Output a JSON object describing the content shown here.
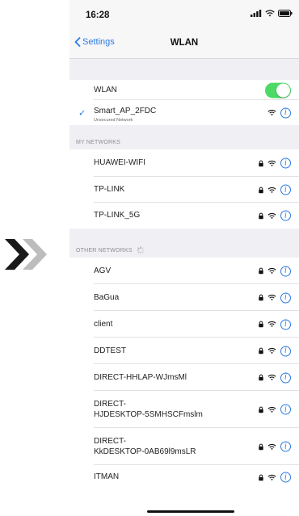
{
  "status": {
    "time": "16:28"
  },
  "nav": {
    "back_label": "Settings",
    "title": "WLAN"
  },
  "wlan": {
    "label": "WLAN",
    "enabled": true
  },
  "connected": {
    "name": "Smart_AP_2FDC",
    "subtitle": "Unsecured Network"
  },
  "my_networks": {
    "header": "MY NETWORKS",
    "items": [
      {
        "name": "HUAWEI-WIFI",
        "locked": true
      },
      {
        "name": "TP-LINK",
        "locked": true
      },
      {
        "name": "TP-LINK_5G",
        "locked": true
      }
    ]
  },
  "other_networks": {
    "header": "OTHER NETWORKS",
    "items": [
      {
        "name": "AGV",
        "locked": true
      },
      {
        "name": "BaGua",
        "locked": true
      },
      {
        "name": "client",
        "locked": true
      },
      {
        "name": "DDTEST",
        "locked": true
      },
      {
        "name": "DIRECT-HHLAP-WJmsMl",
        "locked": true
      },
      {
        "name": "DIRECT-\nHJDESKTOP-5SMHSCFmslm",
        "locked": true
      },
      {
        "name": "DIRECT-\nKkDESKTOP-0AB69l9msLR",
        "locked": true
      },
      {
        "name": "ITMAN",
        "locked": true
      }
    ]
  },
  "colors": {
    "accent": "#2a7ae4",
    "toggle_on": "#4cd964",
    "chevron_dark": "#1a1a1a",
    "chevron_light": "#bdbdbd"
  },
  "icons": {
    "back": "chevron-left-icon",
    "lock": "lock-icon",
    "wifi": "wifi-icon",
    "info": "info-icon",
    "check": "checkmark-icon",
    "spinner": "activity-spinner-icon",
    "cellular": "cellular-signal-icon",
    "battery": "battery-icon"
  }
}
